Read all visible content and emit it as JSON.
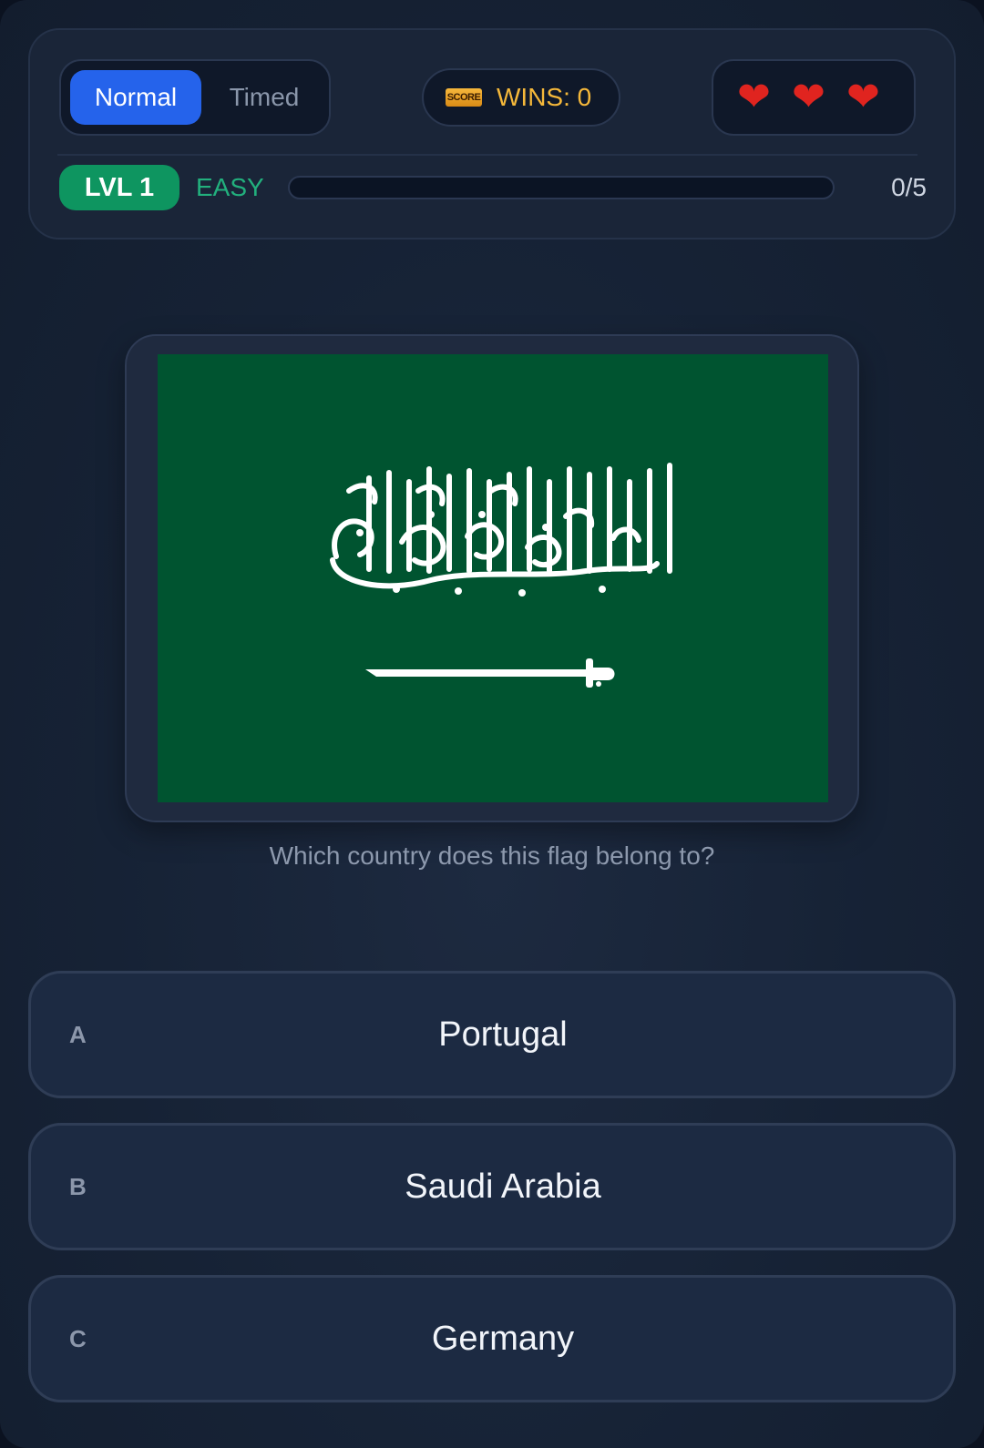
{
  "mode_toggle": {
    "normal_label": "Normal",
    "timed_label": "Timed",
    "selected": "Normal"
  },
  "score": {
    "icon_label": "SCORE",
    "wins_text": "WINS: 0"
  },
  "lives": {
    "remaining": 3,
    "icon": "heart-icon"
  },
  "level": {
    "badge": "LVL 1",
    "difficulty": "EASY",
    "progress_text": "0/5",
    "progress_fraction": 0
  },
  "question": {
    "flag": "saudi-arabia-flag",
    "prompt": "Which country does this flag belong to?"
  },
  "answers": [
    {
      "letter": "A",
      "text": "Portugal"
    },
    {
      "letter": "B",
      "text": "Saudi Arabia"
    },
    {
      "letter": "C",
      "text": "Germany"
    }
  ],
  "colors": {
    "background": "#162235",
    "accent_blue": "#2563eb",
    "level_green": "#0e9560",
    "wins_gold": "#f5b83a",
    "heart_red": "#e0241f",
    "flag_green": "#005430"
  }
}
